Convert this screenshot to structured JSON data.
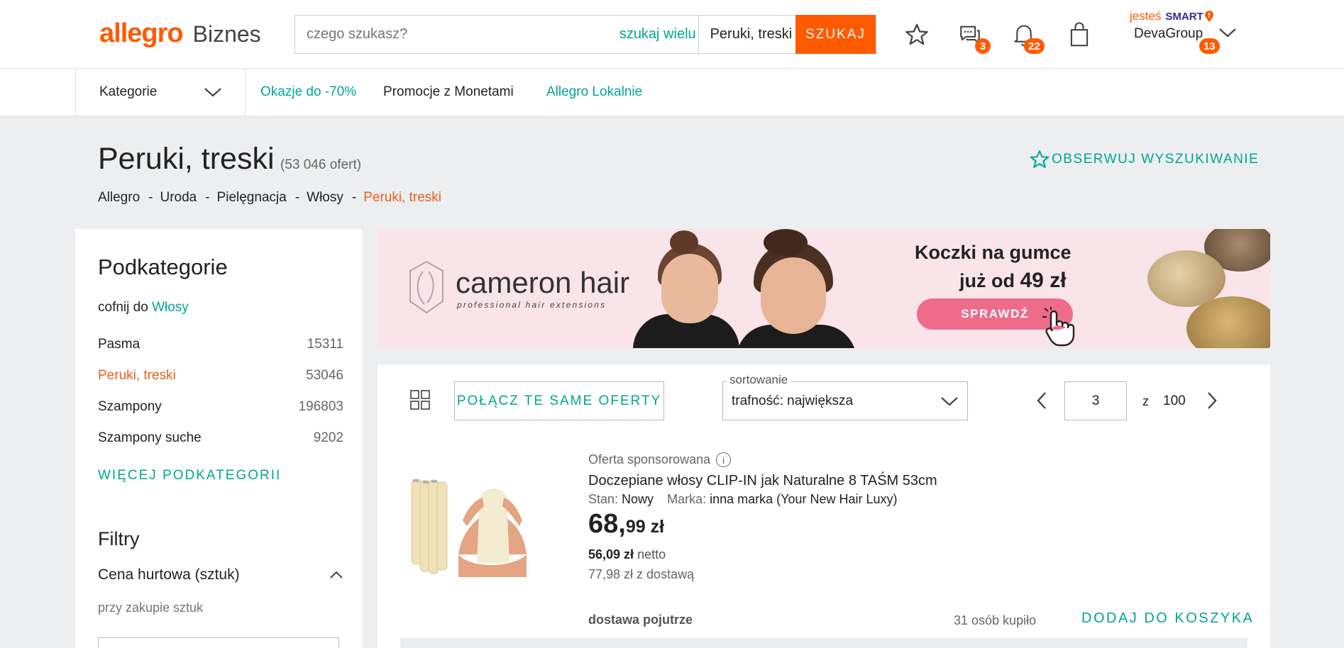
{
  "header": {
    "logo_main": "allegro",
    "logo_sub": "Biznes",
    "search_placeholder": "czego szukasz?",
    "search_multi": "szukaj wielu",
    "search_category": "Peruki, treski",
    "search_button": "SZUKAJ",
    "messages_badge": "3",
    "notifications_badge": "22",
    "smart_prefix": "jesteś",
    "smart_word": "SMART",
    "user_name": "DevaGroup",
    "user_badge": "13"
  },
  "subnav": {
    "categories": "Kategorie",
    "links": [
      "Okazje do -70%",
      "Promocje z Monetami",
      "Allegro Lokalnie"
    ]
  },
  "page": {
    "title": "Peruki, treski",
    "offers_count": "(53 046 ofert)",
    "observe": "OBSERWUJ WYSZUKIWANIE",
    "breadcrumbs": [
      "Allegro",
      "Uroda",
      "Pielęgnacja",
      "Włosy",
      "Peruki, treski"
    ]
  },
  "sidebar": {
    "title": "Podkategorie",
    "back_prefix": "cofnij do",
    "back_link": "Włosy",
    "items": [
      {
        "label": "Pasma",
        "count": "15311"
      },
      {
        "label": "Peruki, treski",
        "count": "53046"
      },
      {
        "label": "Szampony",
        "count": "196803"
      },
      {
        "label": "Szampony suche",
        "count": "9202"
      }
    ],
    "more": "WIĘCEJ PODKATEGORII",
    "filters_title": "Filtry",
    "price_filter": "Cena hurtowa (sztuk)",
    "qty_hint": "przy zakupie sztuk"
  },
  "banner": {
    "brand": "cameron hair",
    "brand_sub": "professional hair extensions",
    "headline1": "Koczki na gumce",
    "headline2_prefix": "już od",
    "headline2_price": "49 zł",
    "button": "SPRAWDŹ"
  },
  "toolbar": {
    "merge_button": "POŁĄCZ TE SAME OFERTY",
    "sort_label": "sortowanie",
    "sort_value": "trafność: największa",
    "page_current": "3",
    "page_of": "z",
    "page_total": "100"
  },
  "offer": {
    "sponsored": "Oferta sponsorowana",
    "title": "Doczepiane włosy CLIP-IN jak Naturalne 8 TAŚM 53cm",
    "stan_label": "Stan:",
    "stan_value": "Nowy",
    "marka_label": "Marka:",
    "marka_value": "inna marka (Your New Hair Luxy)",
    "price_int": "68,",
    "price_dec": "99 zł",
    "netto_value": "56,09 zł",
    "netto_label": "netto",
    "delivery_price": "77,98 zł z dostawą",
    "shipping": "dostawa pojutrze",
    "bought": "31 osób kupiło",
    "add_to_cart": "DODAJ DO KOSZYKA"
  },
  "colors": {
    "brand_orange": "#ff5a00",
    "link_teal": "#00a790",
    "page_bg": "#eceef0"
  }
}
